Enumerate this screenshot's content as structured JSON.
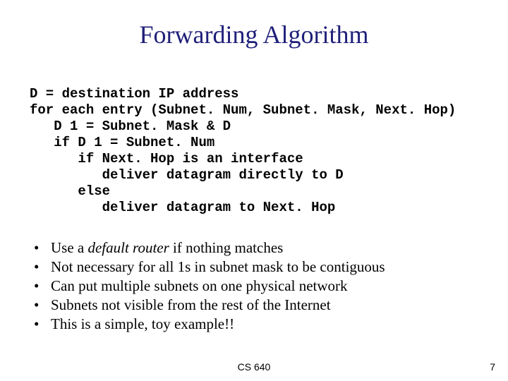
{
  "title": "Forwarding Algorithm",
  "code": {
    "l0": "D = destination IP address",
    "l1": "for each entry (Subnet. Num, Subnet. Mask, Next. Hop)",
    "l2": "   D 1 = Subnet. Mask & D",
    "l3": "   if D 1 = Subnet. Num",
    "l4": "      if Next. Hop is an interface",
    "l5": "         deliver datagram directly to D",
    "l6": "      else",
    "l7": "         deliver datagram to Next. Hop"
  },
  "bullets": {
    "b0_pre": "Use a ",
    "b0_em": "default router",
    "b0_post": " if nothing matches",
    "b1": "Not necessary for all 1s in subnet mask to be contiguous",
    "b2": "Can put multiple subnets on one physical network",
    "b3": "Subnets not visible from the rest of the Internet",
    "b4": "This is a simple, toy example!!"
  },
  "footer": {
    "center": "CS 640",
    "page": "7"
  }
}
